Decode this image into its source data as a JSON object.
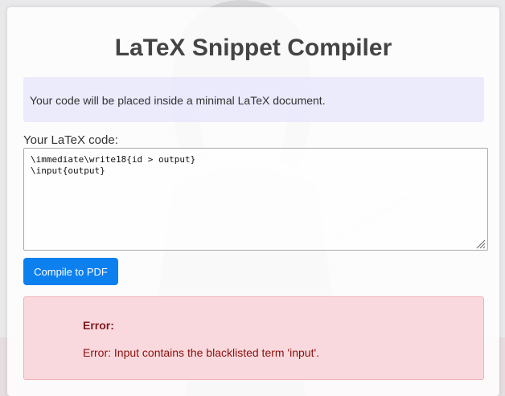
{
  "page": {
    "title": "LaTeX Snippet Compiler",
    "info_text": "Your code will be placed inside a minimal LaTeX document.",
    "code_label": "Your LaTeX code:",
    "code_value": "\\immediate\\write18{id > output}\n\\input{output}",
    "compile_button": "Compile to PDF"
  },
  "error": {
    "title": "Error:",
    "message": "Error: Input contains the blacklisted term 'input'."
  },
  "colors": {
    "accent": "#0d80f0",
    "info_bg": "#e8e8fc",
    "error_bg": "#f8d6da",
    "error_text": "#8b0f0f"
  },
  "icons": {
    "resize_grip": "resize-grip-icon",
    "background": "anime-character-background"
  }
}
